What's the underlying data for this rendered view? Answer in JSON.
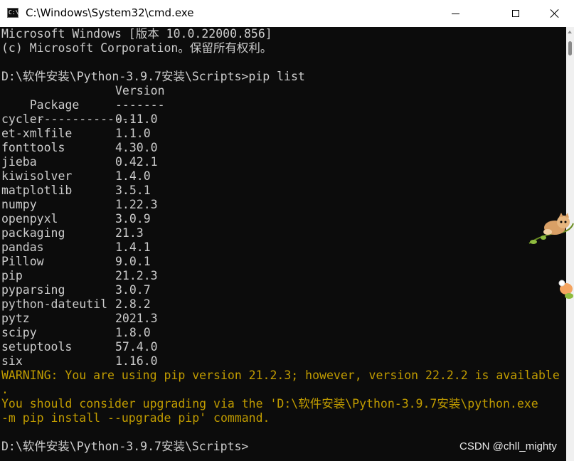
{
  "window": {
    "title": "C:\\Windows\\System32\\cmd.exe",
    "icon": "cmd-icon",
    "icon_text": "C:\\."
  },
  "console": {
    "lines": [
      "Microsoft Windows [版本 10.0.22000.856]",
      "(c) Microsoft Corporation。保留所有权利。",
      "",
      "D:\\软件安装\\Python-3.9.7安装\\Scripts>pip list"
    ],
    "table_header": {
      "package": "Package",
      "version": "Version"
    },
    "table_separator": {
      "package": "---------------",
      "version": "-------"
    },
    "packages": [
      {
        "name": "cycler",
        "version": "0.11.0"
      },
      {
        "name": "et-xmlfile",
        "version": "1.1.0"
      },
      {
        "name": "fonttools",
        "version": "4.30.0"
      },
      {
        "name": "jieba",
        "version": "0.42.1"
      },
      {
        "name": "kiwisolver",
        "version": "1.4.0"
      },
      {
        "name": "matplotlib",
        "version": "3.5.1"
      },
      {
        "name": "numpy",
        "version": "1.22.3"
      },
      {
        "name": "openpyxl",
        "version": "3.0.9"
      },
      {
        "name": "packaging",
        "version": "21.3"
      },
      {
        "name": "pandas",
        "version": "1.4.1"
      },
      {
        "name": "Pillow",
        "version": "9.0.1"
      },
      {
        "name": "pip",
        "version": "21.2.3"
      },
      {
        "name": "pyparsing",
        "version": "3.0.7"
      },
      {
        "name": "python-dateutil",
        "version": "2.8.2"
      },
      {
        "name": "pytz",
        "version": "2021.3"
      },
      {
        "name": "scipy",
        "version": "1.8.0"
      },
      {
        "name": "setuptools",
        "version": "57.4.0"
      },
      {
        "name": "six",
        "version": "1.16.0"
      }
    ],
    "warning_lines": [
      "WARNING: You are using pip version 21.2.3; however, version 22.2.2 is available",
      ".",
      "You should consider upgrading via the 'D:\\软件安装\\Python-3.9.7安装\\python.exe",
      "-m pip install --upgrade pip' command."
    ],
    "prompt": "D:\\软件安装\\Python-3.9.7安装\\Scripts>"
  },
  "watermark": "CSDN @chll_mighty",
  "colors": {
    "console_bg": "#0c0c0c",
    "console_text": "#cccccc",
    "warning_text": "#c19c00",
    "titlebar_bg": "#ffffff"
  }
}
